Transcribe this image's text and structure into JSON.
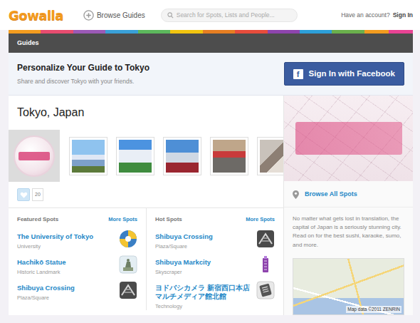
{
  "header": {
    "logo": "Gowalla",
    "browse": "Browse Guides",
    "search_placeholder": "Search for Spots, Lists and People...",
    "account_prompt": "Have an account?",
    "sign_in": "Sign In"
  },
  "section_bar": {
    "title": "Guides"
  },
  "personalize": {
    "title": "Personalize Your Guide to Tokyo",
    "subtitle": "Share and discover Tokyo with your friends.",
    "button_icon": "f",
    "button": "Sign In with Facebook"
  },
  "guide": {
    "title": "Tokyo, Japan",
    "like_count": "20"
  },
  "featured": {
    "title": "Featured Spots",
    "more": "More Spots",
    "spots": [
      {
        "name": "The University of Tokyo",
        "category": "University",
        "kind": "university"
      },
      {
        "name": "Hachikō Statue",
        "category": "Historic Landmark",
        "kind": "landmark"
      },
      {
        "name": "Shibuya Crossing",
        "category": "Plaza/Square",
        "kind": "plaza"
      }
    ]
  },
  "hot": {
    "title": "Hot Spots",
    "more": "More Spots",
    "spots": [
      {
        "name": "Shibuya Crossing",
        "category": "Plaza/Square",
        "kind": "plaza"
      },
      {
        "name": "Shibuya Markcity",
        "category": "Skyscraper",
        "kind": "skyscraper"
      },
      {
        "name": "ヨドバシカメラ 新宿西口本店 マルチメディア館北館",
        "category": "Technology",
        "kind": "technology"
      }
    ]
  },
  "sidebar": {
    "browse_all": "Browse All Spots",
    "description": "No matter what gets lost in translation, the capital of Japan is a seriously stunning city. Read on for the best sushi, karaoke, sumo, and more.",
    "map_attribution": "Map data ©2011 ZENRIN"
  }
}
